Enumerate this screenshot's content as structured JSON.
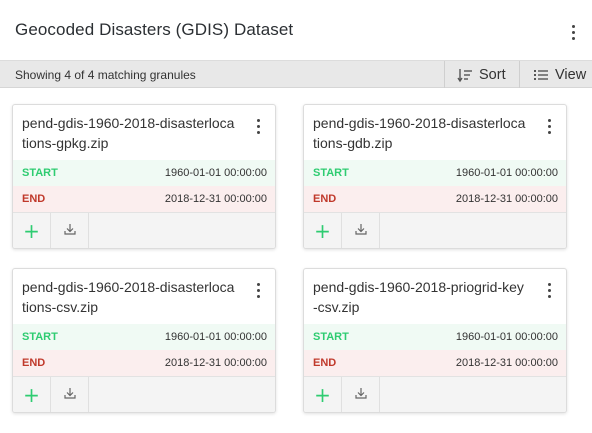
{
  "header": {
    "title": "Geocoded Disasters (GDIS) Dataset",
    "menu_icon": "more-vertical-icon"
  },
  "toolbar": {
    "status": "Showing 4 of 4 matching granules",
    "sort_label": "Sort",
    "view_label": "View"
  },
  "granules": [
    {
      "name": "pend-gdis-1960-2018-disasterlocations-gpkg.zip",
      "start_label": "START",
      "start": "1960-01-01 00:00:00",
      "end_label": "END",
      "end": "2018-12-31 00:00:00"
    },
    {
      "name": "pend-gdis-1960-2018-disasterlocations-gdb.zip",
      "start_label": "START",
      "start": "1960-01-01 00:00:00",
      "end_label": "END",
      "end": "2018-12-31 00:00:00"
    },
    {
      "name": "pend-gdis-1960-2018-disasterlocations-csv.zip",
      "start_label": "START",
      "start": "1960-01-01 00:00:00",
      "end_label": "END",
      "end": "2018-12-31 00:00:00"
    },
    {
      "name": "pend-gdis-1960-2018-priogrid-key-csv.zip",
      "start_label": "START",
      "start": "1960-01-01 00:00:00",
      "end_label": "END",
      "end": "2018-12-31 00:00:00"
    }
  ],
  "colors": {
    "start": "#2ecc71",
    "end": "#c0392b",
    "add": "#2ecc71"
  }
}
